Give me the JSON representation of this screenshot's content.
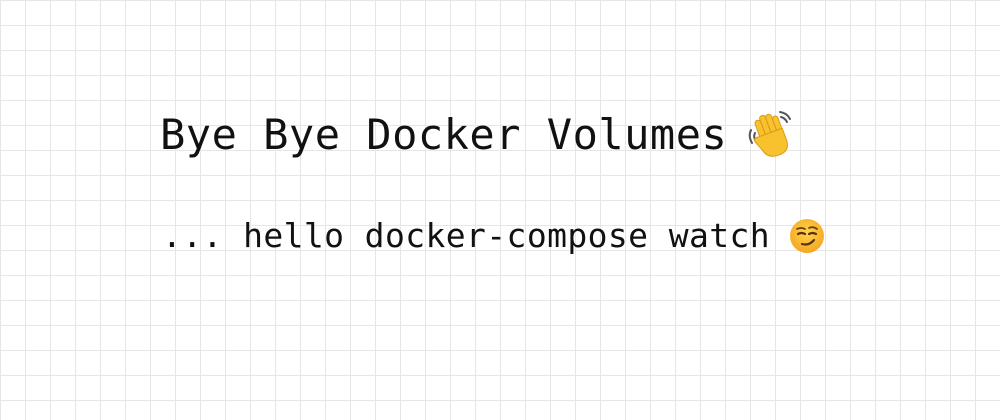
{
  "heading": {
    "title": "Bye Bye Docker Volumes",
    "title_icon": "waving-hand-icon",
    "subtitle": "... hello docker-compose watch",
    "subtitle_icon": "smirking-face-icon"
  },
  "colors": {
    "text": "#111111",
    "grid_line": "#e6e6e6",
    "background": "#ffffff",
    "emoji_yellow": "#fcc21b"
  }
}
